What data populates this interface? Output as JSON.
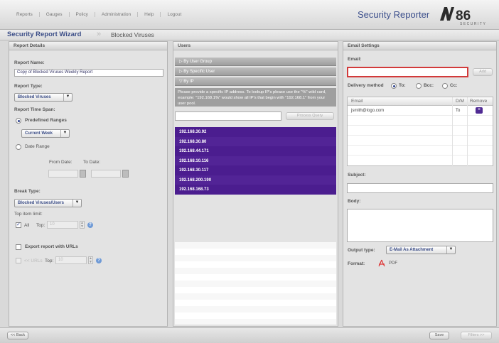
{
  "nav": [
    "Reports",
    "Gauges",
    "Policy",
    "Administration",
    "Help",
    "Logout"
  ],
  "brand": "Security Reporter",
  "logo_text": "M86 SECURITY",
  "breadcrumb": {
    "wizard": "Security Report Wizard",
    "page": "Blocked Viruses"
  },
  "report_details": {
    "header": "Report Details",
    "name_label": "Report Name:",
    "name_value": "Copy of Blocked Viruses Weekly Report",
    "type_label": "Report Type:",
    "type_value": "Blocked Viruses",
    "timespan_label": "Report Time Span:",
    "predefined_label": "Predefined Ranges",
    "predefined_value": "Current Week",
    "date_range_label": "Date Range",
    "from_label": "From Date:",
    "to_label": "To Date:",
    "break_label": "Break Type:",
    "break_value": "Blocked Viruses/Users",
    "top_limit_label": "Top item limit:",
    "all_label": "All",
    "top_label": "Top:",
    "top_value": "10",
    "export_label": "Export report with URLs",
    "urls_label": "<< URLs",
    "top2_label": "Top:",
    "top2_value": "10"
  },
  "users": {
    "header": "Users",
    "by_group": "▷ By User Group",
    "by_user": "▷ By Specific User",
    "by_ip": "▽ By IP",
    "hint": "Please provide a specific IP address. To lookup IP's please use the \"%\" wild card, example: \"192.168.1%\" would show all IP's that begin with \"192.168.1\" from your user pool.",
    "lookup_button": "Process Query",
    "ips": [
      "192.168.30.92",
      "192.168.30.80",
      "192.168.44.171",
      "192.168.10.116",
      "192.168.30.117",
      "192.168.200.190",
      "192.168.168.73"
    ]
  },
  "email": {
    "header": "Email Settings",
    "email_label": "Email:",
    "add_button": "Add",
    "delivery_label": "Delivery method",
    "to_label": "To:",
    "bcc_label": "Bcc:",
    "cc_label": "Cc:",
    "col_email": "Email",
    "col_dm": "D/M",
    "col_remove": "Remove",
    "recipients": [
      {
        "email": "jsmith@logo.com",
        "method": "To"
      }
    ],
    "subject_label": "Subject:",
    "body_label": "Body:",
    "output_label": "Output type:",
    "output_value": "E-Mail As Attachment",
    "format_label": "Format:",
    "format_value": "PDF"
  },
  "footer": {
    "back": "<< Back",
    "save": "Save",
    "filters": "Filters >>"
  },
  "colors": {
    "accent": "#4b1d8f",
    "brand": "#3c4f8c",
    "error": "#d23a3a"
  }
}
